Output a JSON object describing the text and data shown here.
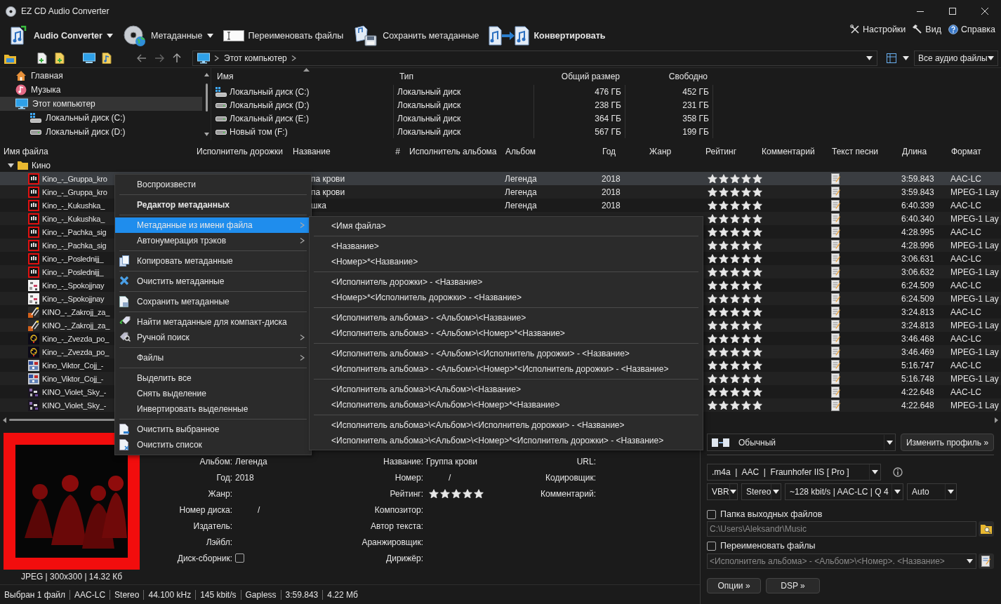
{
  "window": {
    "title": "EZ CD Audio Converter"
  },
  "toolbar": {
    "buttons": [
      {
        "label": "Audio Converter",
        "primary": true,
        "dropdown": true
      },
      {
        "label": "Метаданные",
        "primary": false,
        "dropdown": true
      },
      {
        "label": "Переименовать файлы",
        "primary": false,
        "dropdown": false
      },
      {
        "label": "Сохранить метаданные",
        "primary": false,
        "dropdown": false
      },
      {
        "label": "Конвертировать",
        "primary": true,
        "dropdown": false
      }
    ],
    "right_buttons": [
      "Настройки",
      "Вид",
      "Справка"
    ]
  },
  "navigation": {
    "path": "Этот компьютер",
    "filter": "Все аудио файлы"
  },
  "tree": {
    "items": [
      {
        "label": "Главная",
        "selected": false
      },
      {
        "label": "Музыка",
        "selected": false
      },
      {
        "label": "Этот компьютер",
        "selected": true,
        "children": [
          {
            "label": "Локальный диск (C:)",
            "selected": false
          },
          {
            "label": "Локальный диск (D:)",
            "selected": false
          }
        ]
      }
    ]
  },
  "drives": {
    "columns": [
      "Имя",
      "Тип",
      "Общий размер",
      "Свободно"
    ],
    "rows": [
      {
        "name": "Локальный диск (C:)",
        "type": "Локальный диск",
        "total": "476 ГБ",
        "free": "452 ГБ"
      },
      {
        "name": "Локальный диск (D:)",
        "type": "Локальный диск",
        "total": "238 ГБ",
        "free": "231 ГБ"
      },
      {
        "name": "Локальный диск (E:)",
        "type": "Локальный диск",
        "total": "364 ГБ",
        "free": "358 ГБ"
      },
      {
        "name": "Новый том (F:)",
        "type": "Локальный диск",
        "total": "567 ГБ",
        "free": "199 ГБ"
      }
    ]
  },
  "tracks": {
    "columns": [
      "Имя файла",
      "Исполнитель дорожки",
      "Название",
      "#",
      "Исполнитель альбома",
      "Альбом",
      "Год",
      "Жанр",
      "Рейтинг",
      "Комментарий",
      "Текст песни",
      "Длина",
      "Формат"
    ],
    "group": {
      "label": "Кино",
      "expanded": true
    },
    "rows": [
      {
        "file": "Kino_-_Gruppa_kro",
        "title": "па крови",
        "album": "Легенда",
        "year": "2018",
        "stars": 5,
        "lyrics": true,
        "length": "3:59.843",
        "format": "AAC-LC",
        "selected": true
      },
      {
        "file": "Kino_-_Gruppa_kro",
        "title": "па крови",
        "album": "Легенда",
        "year": "2018",
        "stars": 5,
        "lyrics": true,
        "length": "3:59.843",
        "format": "MPEG-1 Lay",
        "selected": false
      },
      {
        "file": "Kino_-_Kukushka_",
        "title": "шка",
        "album": "Легенда",
        "year": "2018",
        "stars": 5,
        "lyrics": true,
        "length": "6:40.339",
        "format": "AAC-LC",
        "selected": false
      },
      {
        "file": "Kino_-_Kukushka_",
        "stars": 5,
        "lyrics": true,
        "length": "6:40.340",
        "format": "MPEG-1 Lay",
        "selected": false
      },
      {
        "file": "Kino_-_Pachka_sig",
        "stars": 5,
        "lyrics": true,
        "length": "4:28.995",
        "format": "AAC-LC",
        "selected": false
      },
      {
        "file": "Kino_-_Pachka_sig",
        "stars": 5,
        "lyrics": true,
        "length": "4:28.996",
        "format": "MPEG-1 Lay",
        "selected": false
      },
      {
        "file": "Kino_-_Poslednijj_",
        "stars": 5,
        "lyrics": true,
        "length": "3:06.631",
        "format": "AAC-LC",
        "selected": false
      },
      {
        "file": "Kino_-_Poslednijj_",
        "stars": 5,
        "lyrics": true,
        "length": "3:06.632",
        "format": "MPEG-1 Lay",
        "selected": false
      },
      {
        "file": "Kino_-_Spokojjnay",
        "stars": 5,
        "lyrics": true,
        "length": "6:24.509",
        "format": "AAC-LC",
        "selected": false
      },
      {
        "file": "Kino_-_Spokojjnay",
        "stars": 5,
        "lyrics": true,
        "length": "6:24.509",
        "format": "MPEG-1 Lay",
        "selected": false
      },
      {
        "file": "KINO_-_Zakrojj_za_",
        "stars": 5,
        "lyrics": true,
        "length": "3:24.813",
        "format": "AAC-LC",
        "selected": false
      },
      {
        "file": "KINO_-_Zakrojj_za_",
        "stars": 5,
        "lyrics": true,
        "length": "3:24.813",
        "format": "MPEG-1 Lay",
        "selected": false
      },
      {
        "file": "Kino_-_Zvezda_po_",
        "stars": 5,
        "lyrics": true,
        "length": "3:46.468",
        "format": "AAC-LC",
        "selected": false
      },
      {
        "file": "Kino_-_Zvezda_po_",
        "stars": 5,
        "lyrics": true,
        "length": "3:46.469",
        "format": "MPEG-1 Lay",
        "selected": false
      },
      {
        "file": "Kino_Viktor_Cojj_-",
        "stars": 5,
        "lyrics": true,
        "length": "5:16.747",
        "format": "AAC-LC",
        "selected": false
      },
      {
        "file": "Kino_Viktor_Cojj_-",
        "stars": 5,
        "lyrics": true,
        "length": "5:16.748",
        "format": "MPEG-1 Lay",
        "selected": false
      },
      {
        "file": "KINO_Violet_Sky_-",
        "stars": 5,
        "lyrics": true,
        "length": "4:22.648",
        "format": "AAC-LC",
        "selected": false
      },
      {
        "file": "KINO_Violet_Sky_-",
        "stars": 5,
        "lyrics": true,
        "length": "4:22.648",
        "format": "MPEG-1 Lay",
        "selected": false
      }
    ]
  },
  "context_menu": {
    "groups": [
      [
        {
          "label": "Воспроизвести",
          "default": false,
          "selected": false,
          "has_submenu": false
        }
      ],
      [
        {
          "label": "Редактор метаданных",
          "default": true,
          "selected": false,
          "has_submenu": false
        }
      ],
      [
        {
          "label": "Метаданные из имени файла",
          "default": false,
          "selected": true,
          "has_submenu": true
        },
        {
          "label": "Автонумерация трэков",
          "default": false,
          "selected": false,
          "has_submenu": true
        }
      ],
      [
        {
          "label": "Копировать метаданные",
          "default": false,
          "selected": false,
          "has_submenu": false
        }
      ],
      [
        {
          "label": "Очистить метаданные",
          "default": false,
          "selected": false,
          "has_submenu": false
        }
      ],
      [
        {
          "label": "Сохранить метаданные",
          "default": false,
          "selected": false,
          "has_submenu": false
        }
      ],
      [
        {
          "label": "Найти метаданные для компакт-диска",
          "default": false,
          "selected": false,
          "has_submenu": false
        },
        {
          "label": "Ручной поиск",
          "default": false,
          "selected": false,
          "has_submenu": true
        }
      ],
      [
        {
          "label": "Файлы",
          "default": false,
          "selected": false,
          "has_submenu": true
        }
      ],
      [
        {
          "label": "Выделить все",
          "default": false,
          "selected": false,
          "has_submenu": false
        },
        {
          "label": "Снять выделение",
          "default": false,
          "selected": false,
          "has_submenu": false
        },
        {
          "label": "Инвертировать выделенные",
          "default": false,
          "selected": false,
          "has_submenu": false
        }
      ],
      [
        {
          "label": "Очистить выбранное",
          "default": false,
          "selected": false,
          "has_submenu": false
        },
        {
          "label": "Очистить список",
          "default": false,
          "selected": false,
          "has_submenu": false
        }
      ]
    ]
  },
  "submenu": {
    "groups": [
      [
        "<Имя файла>"
      ],
      [
        "<Название>",
        "<Номер>*<Название>"
      ],
      [
        "<Исполнитель дорожки> - <Название>",
        "<Номер>*<Исполнитель дорожки> - <Название>"
      ],
      [
        "<Исполнитель альбома> - <Альбом>\\<Название>",
        "<Исполнитель альбома> - <Альбом>\\<Номер>*<Название>"
      ],
      [
        "<Исполнитель альбома> - <Альбом>\\<Исполнитель дорожки> - <Название>",
        "<Исполнитель альбома> - <Альбом>\\<Номер>*<Исполнитель дорожки> - <Название>"
      ],
      [
        "<Исполнитель альбома>\\<Альбом>\\<Название>",
        "<Исполнитель альбома>\\<Альбом>\\<Номер>*<Название>"
      ],
      [
        "<Исполнитель альбома>\\<Альбом>\\<Исполнитель дорожки> - <Название>",
        "<Исполнитель альбома>\\<Альбом>\\<Номер>*<Исполнитель дорожки> - <Название>"
      ]
    ]
  },
  "details": {
    "art": {
      "kind": "picture",
      "caption": "JPEG | 300x300 | 14.32 Кб"
    },
    "columns": [
      [
        {
          "label": "Альбом:",
          "kind": "text",
          "value": "Легенда"
        },
        {
          "label": "Год:",
          "kind": "text",
          "value": "2018"
        },
        {
          "label": "Жанр:",
          "kind": "text"
        },
        {
          "label": "Номер диска:",
          "kind": "pair",
          "value": "/"
        },
        {
          "label": "Издатель:",
          "kind": "text"
        },
        {
          "label": "Лэйбл:",
          "kind": "text"
        },
        {
          "label": "Диск-сборник:",
          "kind": "checkbox",
          "checked": false
        }
      ],
      [
        {
          "label": "Название:",
          "kind": "text",
          "value": "Группа крови"
        },
        {
          "label": "Номер:",
          "kind": "pair",
          "value": "/"
        },
        {
          "label": "Рейтинг:",
          "kind": "stars",
          "stars": 5
        },
        {
          "label": "Композитор:",
          "kind": "text"
        },
        {
          "label": "Автор текста:",
          "kind": "text"
        },
        {
          "label": "Аранжировщик:",
          "kind": "text"
        },
        {
          "label": "Дирижёр:",
          "kind": "text"
        }
      ],
      [
        {
          "label": "URL:",
          "kind": "text"
        },
        {
          "label": "Кодировщик:",
          "kind": "text"
        },
        {
          "label": "Комментарий:",
          "kind": "text"
        }
      ]
    ]
  },
  "output": {
    "profile": "Обычный",
    "edit_profile": "Изменить профиль »",
    "format": ".m4a  |  AAC  |  Fraunhofer IIS [ Pro ]",
    "mode": "VBR",
    "channels": "Stereo",
    "quality": "~128 kbit/s | AAC-LC | Q 4",
    "rate": "Auto",
    "folder": {
      "label": "Папка выходных файлов",
      "checked": false,
      "value": "C:\\Users\\Aleksandr\\Music"
    },
    "rename": {
      "label": "Переименовать файлы",
      "checked": false,
      "value": "<Исполнитель альбома> - <Альбом>\\<Номер>. <Название>"
    },
    "buttons": [
      "Опции »",
      "DSP »"
    ]
  },
  "status_bar": [
    "Выбран 1 файл",
    "AAC-LC",
    "Stereo",
    "44.100 kHz",
    "145 kbit/s",
    "Gapless",
    "3:59.843",
    "4.22 Мб"
  ]
}
